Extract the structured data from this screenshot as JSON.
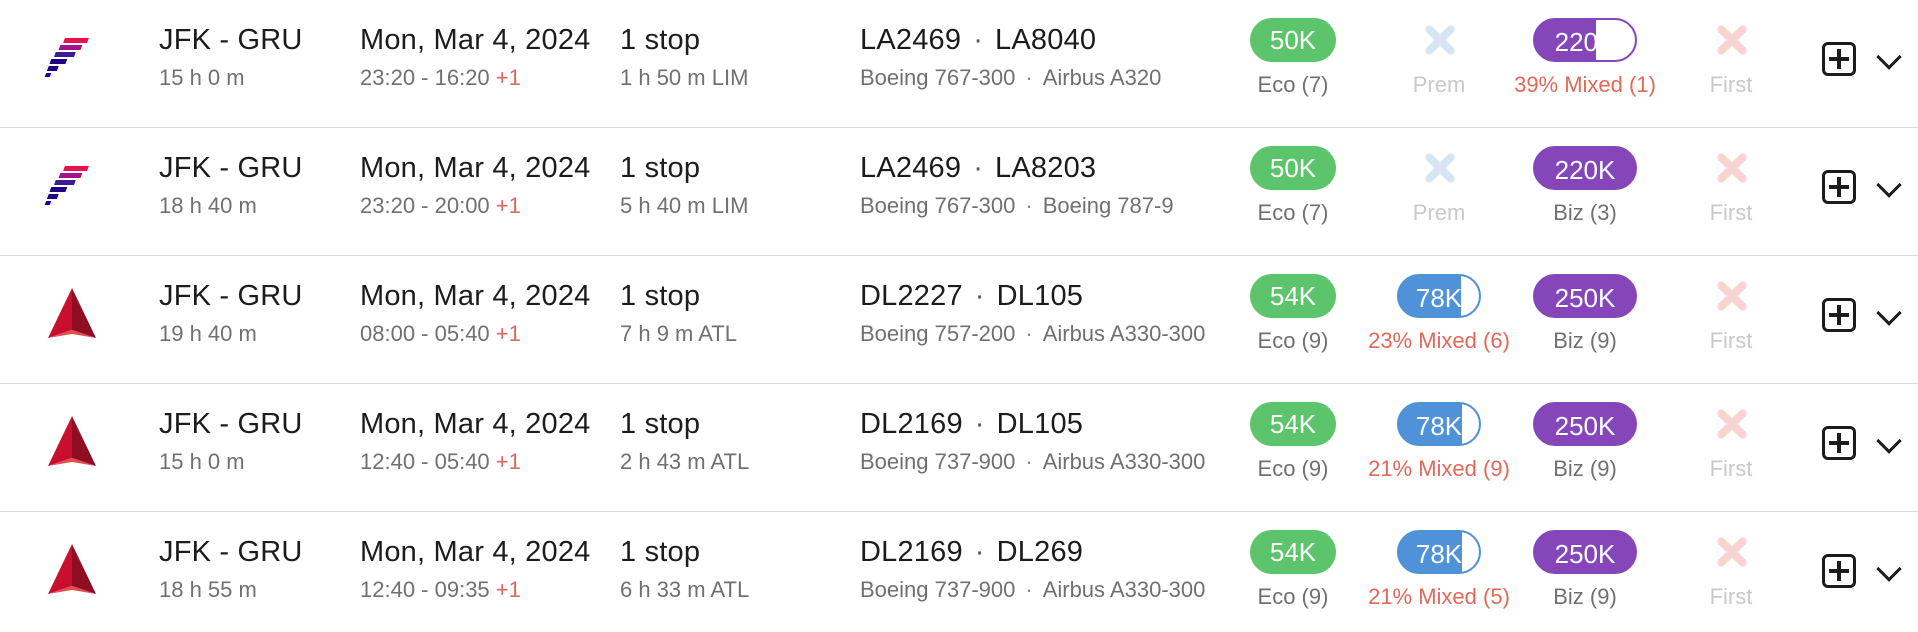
{
  "rows": [
    {
      "airline_logo": "latam-logo",
      "route": "JFK - GRU",
      "duration": "15 h 0 m",
      "date": "Mon, Mar 4, 2024",
      "times": "23:20 - 16:20",
      "day_offset": "+1",
      "stops": "1 stop",
      "layover": "1 h 50 m  LIM",
      "flight_1": "LA2469",
      "flight_2": "LA8040",
      "aircraft_1": "Boeing 767-300",
      "aircraft_2": "Airbus A320",
      "eco": {
        "price": "50K",
        "label": "Eco (7)"
      },
      "prem": {
        "available": false,
        "label": "Prem"
      },
      "biz": {
        "price": "220K",
        "label": "39% Mixed (1)",
        "fill_fraction": 0.39
      },
      "first": {
        "available": false,
        "label": "First"
      }
    },
    {
      "airline_logo": "latam-logo",
      "route": "JFK - GRU",
      "duration": "18 h 40 m",
      "date": "Mon, Mar 4, 2024",
      "times": "23:20 - 20:00",
      "day_offset": "+1",
      "stops": "1 stop",
      "layover": "5 h 40 m  LIM",
      "flight_1": "LA2469",
      "flight_2": "LA8203",
      "aircraft_1": "Boeing 767-300",
      "aircraft_2": "Boeing 787-9",
      "eco": {
        "price": "50K",
        "label": "Eco (7)"
      },
      "prem": {
        "available": false,
        "label": "Prem"
      },
      "biz": {
        "price": "220K",
        "label": "Biz (3)"
      },
      "first": {
        "available": false,
        "label": "First"
      }
    },
    {
      "airline_logo": "delta-logo",
      "route": "JFK - GRU",
      "duration": "19 h 40 m",
      "date": "Mon, Mar 4, 2024",
      "times": "08:00 - 05:40",
      "day_offset": "+1",
      "stops": "1 stop",
      "layover": "7 h 9 m  ATL",
      "flight_1": "DL2227",
      "flight_2": "DL105",
      "aircraft_1": "Boeing 757-200",
      "aircraft_2": "Airbus A330-300",
      "eco": {
        "price": "54K",
        "label": "Eco (9)"
      },
      "prem": {
        "available": true,
        "price": "78K",
        "label": "23% Mixed (6)",
        "fill_fraction": 0.23
      },
      "biz": {
        "price": "250K",
        "label": "Biz (9)"
      },
      "first": {
        "available": false,
        "label": "First"
      }
    },
    {
      "airline_logo": "delta-logo",
      "route": "JFK - GRU",
      "duration": "15 h 0 m",
      "date": "Mon, Mar 4, 2024",
      "times": "12:40 - 05:40",
      "day_offset": "+1",
      "stops": "1 stop",
      "layover": "2 h 43 m  ATL",
      "flight_1": "DL2169",
      "flight_2": "DL105",
      "aircraft_1": "Boeing 737-900",
      "aircraft_2": "Airbus A330-300",
      "eco": {
        "price": "54K",
        "label": "Eco (9)"
      },
      "prem": {
        "available": true,
        "price": "78K",
        "label": "21% Mixed (9)",
        "fill_fraction": 0.21
      },
      "biz": {
        "price": "250K",
        "label": "Biz (9)"
      },
      "first": {
        "available": false,
        "label": "First"
      }
    },
    {
      "airline_logo": "delta-logo",
      "route": "JFK - GRU",
      "duration": "18 h 55 m",
      "date": "Mon, Mar 4, 2024",
      "times": "12:40 - 09:35",
      "day_offset": "+1",
      "stops": "1 stop",
      "layover": "6 h 33 m  ATL",
      "flight_1": "DL2169",
      "flight_2": "DL269",
      "aircraft_1": "Boeing 737-900",
      "aircraft_2": "Airbus A330-300",
      "eco": {
        "price": "54K",
        "label": "Eco (9)"
      },
      "prem": {
        "available": true,
        "price": "78K",
        "label": "21% Mixed (5)",
        "fill_fraction": 0.21
      },
      "biz": {
        "price": "250K",
        "label": "Biz (9)"
      },
      "first": {
        "available": false,
        "label": "First"
      }
    }
  ],
  "colors": {
    "eco": "#5cc46a",
    "prem": "#4f92d8",
    "biz": "#8446b8",
    "mixed_text": "#e2695a",
    "unavailable_prem": "#d6e6f7",
    "unavailable_first": "#f8d3d0"
  },
  "icons": {
    "add": "plus-square-icon",
    "expand": "chevron-down-icon",
    "unavailable": "x-icon"
  }
}
